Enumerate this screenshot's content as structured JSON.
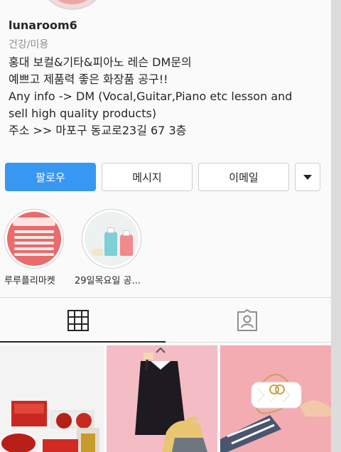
{
  "profile": {
    "username": "lunaroom6",
    "category": "건강/미용",
    "bio_lines": [
      "홍대 보컬&기타&피아노 레슨  DM문의",
      "예쁘고 제품력 좋은 화장품 공구!!",
      "Any info -> DM (Vocal,Guitar,Piano etc lesson and",
      "sell high quality products)",
      "주소 >> 마포구 동교로23길 67 3층"
    ]
  },
  "actions": {
    "follow_label": "팔로우",
    "message_label": "메시지",
    "email_label": "이메일",
    "more_icon": "chevron-down-icon"
  },
  "highlights": [
    {
      "label": "루루플리마켓"
    },
    {
      "label": "29일목요일 공..."
    }
  ],
  "tabs": {
    "active": "grid",
    "items": [
      "grid-icon",
      "tagged-icon"
    ]
  },
  "colors": {
    "accent": "#3897f0",
    "text": "#262626",
    "secondary": "#8e8e8e",
    "border": "#dbdbdb"
  }
}
